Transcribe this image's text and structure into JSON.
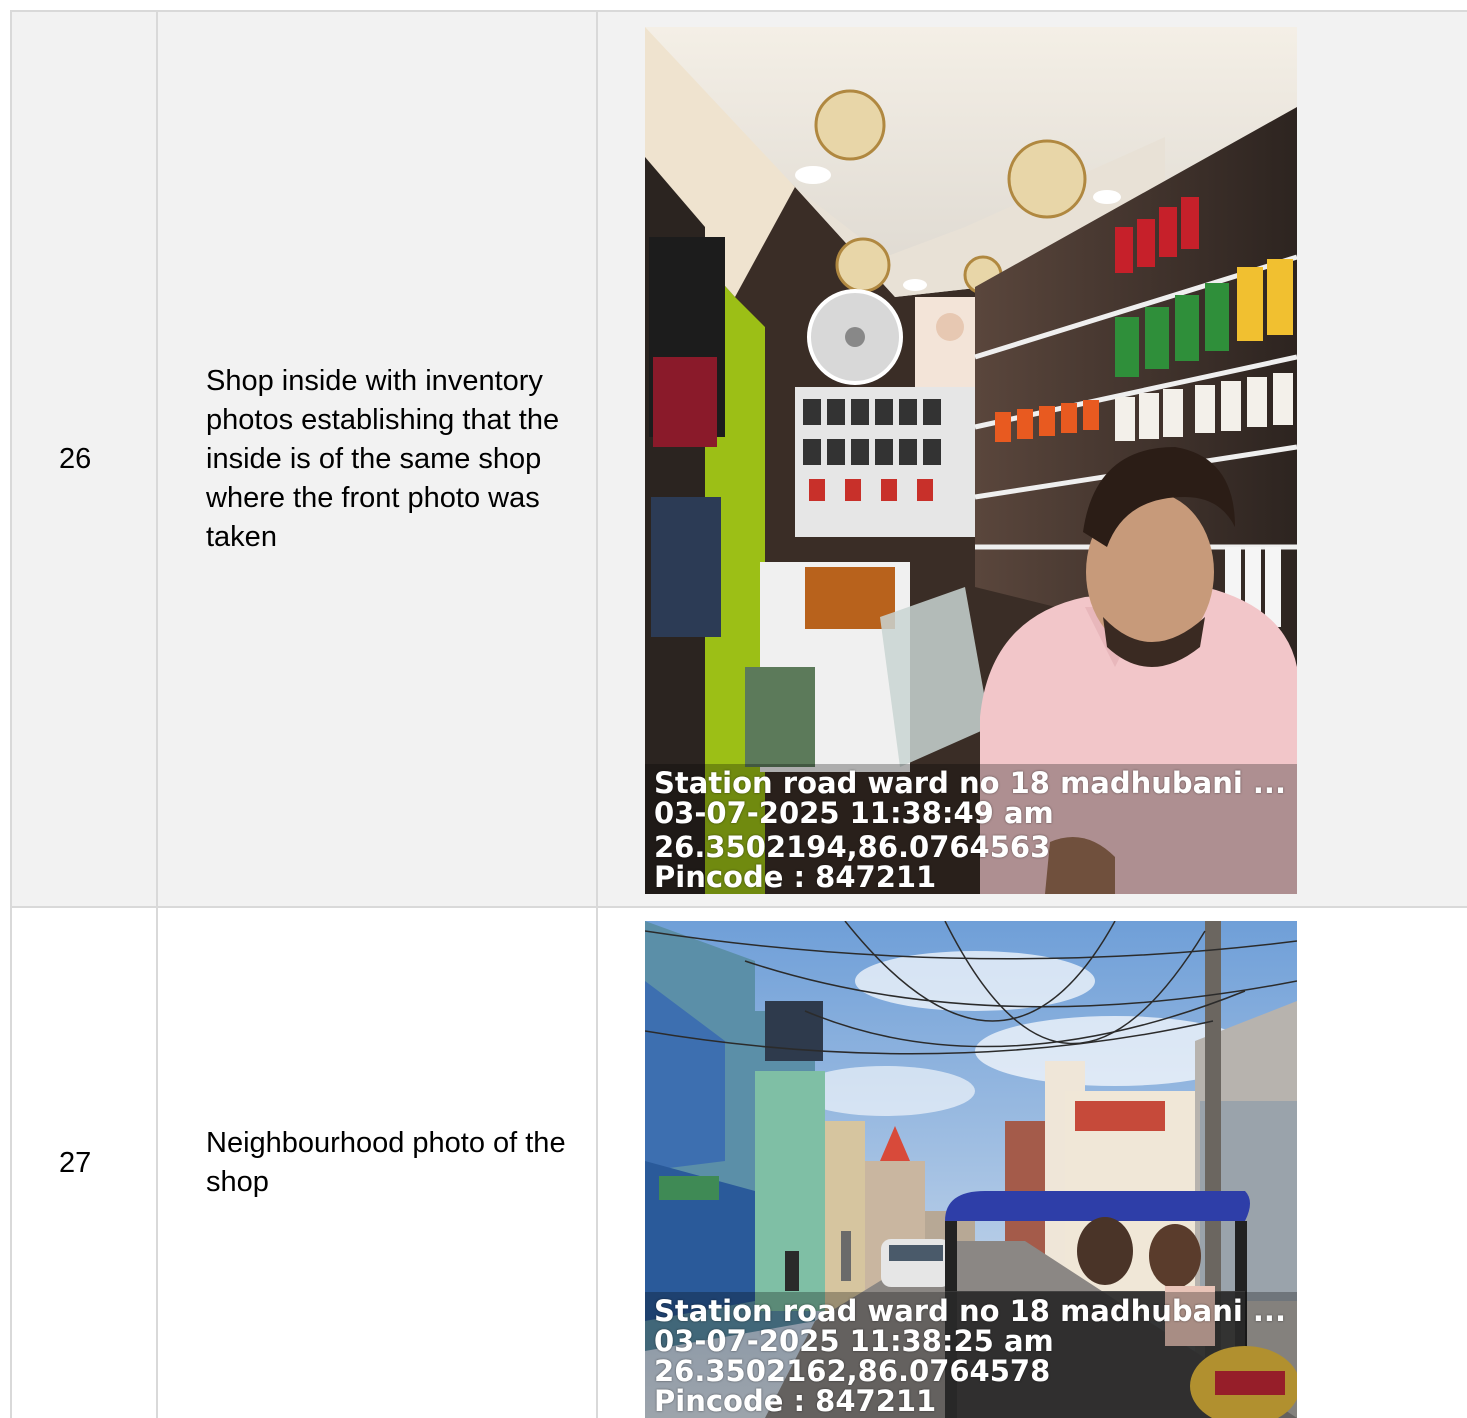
{
  "rows": [
    {
      "number": "26",
      "description": "Shop inside with inventory photos establishing that the inside is of the same shop where the front photo was taken",
      "photo": {
        "subject": "mobile-shop-interior",
        "stamp": {
          "address": "Station road ward no 18 madhubani ...",
          "datetime": "03-07-2025 11:38:49 am",
          "coordinates": "26.3502194,86.0764563",
          "pincode": "Pincode : 847211"
        }
      }
    },
    {
      "number": "27",
      "description": "Neighbourhood photo of the shop",
      "photo": {
        "subject": "street-neighbourhood",
        "stamp": {
          "address": "Station road ward no 18 madhubani ...",
          "datetime": "03-07-2025 11:38:25 am",
          "coordinates": "26.3502162,86.0764578",
          "pincode": "Pincode : 847211"
        }
      }
    }
  ],
  "colors": {
    "row_shaded": "#f2f2f2",
    "grid_border": "#d9d9d9",
    "stamp_text": "#ffffff"
  }
}
